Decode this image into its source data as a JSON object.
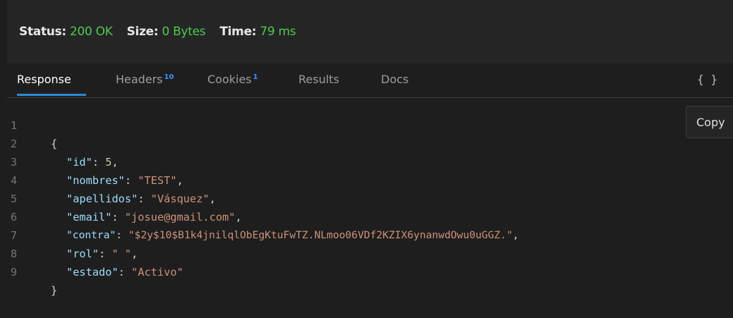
{
  "status": {
    "status_label": "Status:",
    "status_value": "200 OK",
    "size_label": "Size:",
    "size_value": "0 Bytes",
    "time_label": "Time:",
    "time_value": "79 ms"
  },
  "tabs": [
    {
      "label": "Response",
      "badge": ""
    },
    {
      "label": "Headers",
      "badge": "10"
    },
    {
      "label": "Cookies",
      "badge": "1"
    },
    {
      "label": "Results",
      "badge": ""
    },
    {
      "label": "Docs",
      "badge": ""
    }
  ],
  "toolbar": {
    "format_icon": "{ }",
    "copy_label": "Copy"
  },
  "code_lines": [
    {
      "num": "1",
      "open": "{"
    },
    {
      "num": "2",
      "key": "\"id\"",
      "sep": ": ",
      "num_val": "5",
      "end": ","
    },
    {
      "num": "3",
      "key": "\"nombres\"",
      "sep": ": ",
      "str_val": "\"TEST\"",
      "end": ","
    },
    {
      "num": "4",
      "key": "\"apellidos\"",
      "sep": ": ",
      "str_val": "\"Vásquez\"",
      "end": ","
    },
    {
      "num": "5",
      "key": "\"email\"",
      "sep": ": ",
      "str_val": "\"josue@gmail.com\"",
      "end": ","
    },
    {
      "num": "6",
      "key": "\"contra\"",
      "sep": ": ",
      "str_val": "\"$2y$10$B1k4jnilqlObEgKtuFwTZ.NLmoo06VDf2KZIX6ynanwdOwu0uGGZ.\"",
      "end": ","
    },
    {
      "num": "7",
      "key": "\"rol\"",
      "sep": ": ",
      "str_val": "\" \"",
      "end": ","
    },
    {
      "num": "8",
      "key": "\"estado\"",
      "sep": ": ",
      "str_val": "\"Activo\"",
      "end": ""
    },
    {
      "num": "9",
      "close": "}"
    }
  ],
  "colors": {
    "accent": "#2a8ad4",
    "ok": "#4ec94e",
    "badge": "#3794ff"
  }
}
